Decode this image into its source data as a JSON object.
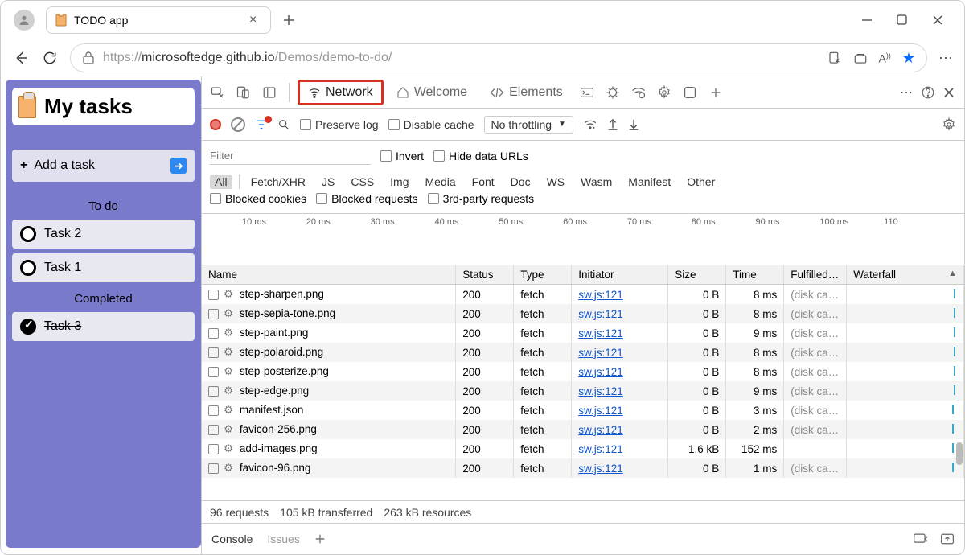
{
  "browser": {
    "tab_title": "TODO app",
    "url_authority": "microsoftedge.github.io",
    "url_path": "/Demos/demo-to-do/",
    "url_scheme": "https://"
  },
  "app": {
    "title": "My tasks",
    "add_task_label": "Add a task",
    "sections": {
      "todo": "To do",
      "completed": "Completed"
    },
    "tasks_todo": [
      {
        "name": "Task 2"
      },
      {
        "name": "Task 1"
      }
    ],
    "tasks_done": [
      {
        "name": "Task 3"
      }
    ]
  },
  "devtools": {
    "tabs": {
      "network": "Network",
      "welcome": "Welcome",
      "elements": "Elements"
    },
    "toolbar": {
      "preserve_log": "Preserve log",
      "disable_cache": "Disable cache",
      "throttle": "No throttling"
    },
    "filter": {
      "placeholder": "Filter",
      "invert": "Invert",
      "hide_data_urls": "Hide data URLs",
      "types": [
        "All",
        "Fetch/XHR",
        "JS",
        "CSS",
        "Img",
        "Media",
        "Font",
        "Doc",
        "WS",
        "Wasm",
        "Manifest",
        "Other"
      ],
      "blocked_cookies": "Blocked cookies",
      "blocked_requests": "Blocked requests",
      "third_party": "3rd-party requests"
    },
    "timeline_ticks": [
      "10 ms",
      "20 ms",
      "30 ms",
      "40 ms",
      "50 ms",
      "60 ms",
      "70 ms",
      "80 ms",
      "90 ms",
      "100 ms",
      "110"
    ],
    "columns": [
      "Name",
      "Status",
      "Type",
      "Initiator",
      "Size",
      "Time",
      "Fulfilled…",
      "Waterfall"
    ],
    "rows": [
      {
        "name": "step-sharpen.png",
        "status": "200",
        "type": "fetch",
        "initiator": "sw.js:121",
        "size": "0 B",
        "time": "8 ms",
        "fulfilled": "(disk ca…",
        "wf": 92
      },
      {
        "name": "step-sepia-tone.png",
        "status": "200",
        "type": "fetch",
        "initiator": "sw.js:121",
        "size": "0 B",
        "time": "8 ms",
        "fulfilled": "(disk ca…",
        "wf": 92
      },
      {
        "name": "step-paint.png",
        "status": "200",
        "type": "fetch",
        "initiator": "sw.js:121",
        "size": "0 B",
        "time": "9 ms",
        "fulfilled": "(disk ca…",
        "wf": 92
      },
      {
        "name": "step-polaroid.png",
        "status": "200",
        "type": "fetch",
        "initiator": "sw.js:121",
        "size": "0 B",
        "time": "8 ms",
        "fulfilled": "(disk ca…",
        "wf": 92
      },
      {
        "name": "step-posterize.png",
        "status": "200",
        "type": "fetch",
        "initiator": "sw.js:121",
        "size": "0 B",
        "time": "8 ms",
        "fulfilled": "(disk ca…",
        "wf": 92
      },
      {
        "name": "step-edge.png",
        "status": "200",
        "type": "fetch",
        "initiator": "sw.js:121",
        "size": "0 B",
        "time": "9 ms",
        "fulfilled": "(disk ca…",
        "wf": 92
      },
      {
        "name": "manifest.json",
        "status": "200",
        "type": "fetch",
        "initiator": "sw.js:121",
        "size": "0 B",
        "time": "3 ms",
        "fulfilled": "(disk ca…",
        "wf": 90
      },
      {
        "name": "favicon-256.png",
        "status": "200",
        "type": "fetch",
        "initiator": "sw.js:121",
        "size": "0 B",
        "time": "2 ms",
        "fulfilled": "(disk ca…",
        "wf": 90
      },
      {
        "name": "add-images.png",
        "status": "200",
        "type": "fetch",
        "initiator": "sw.js:121",
        "size": "1.6 kB",
        "time": "152 ms",
        "fulfilled": "",
        "wf": 90
      },
      {
        "name": "favicon-96.png",
        "status": "200",
        "type": "fetch",
        "initiator": "sw.js:121",
        "size": "0 B",
        "time": "1 ms",
        "fulfilled": "(disk ca…",
        "wf": 90
      }
    ],
    "summary": {
      "requests": "96 requests",
      "transferred": "105 kB transferred",
      "resources": "263 kB resources"
    },
    "drawer": {
      "console": "Console",
      "issues": "Issues"
    }
  }
}
